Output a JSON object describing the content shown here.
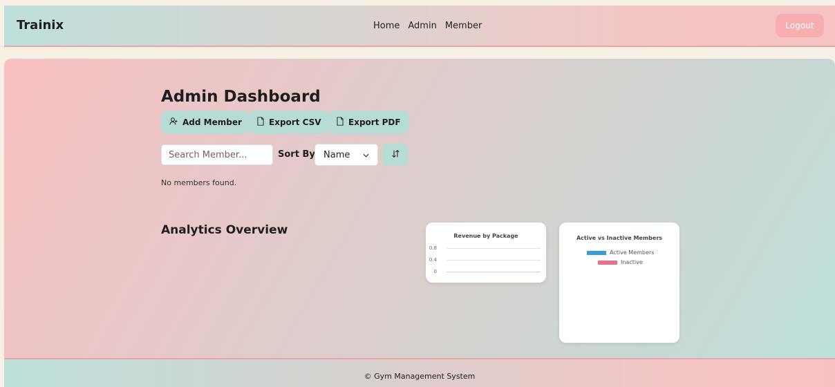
{
  "header": {
    "brand": "Trainix",
    "nav": [
      "Home",
      "Admin",
      "Member"
    ],
    "logout_label": "Logout"
  },
  "main": {
    "title": "Admin Dashboard",
    "buttons": {
      "add_member": "Add Member",
      "export_csv": "Export CSV",
      "export_pdf": "Export PDF"
    },
    "search": {
      "placeholder": "Search Member...",
      "value": ""
    },
    "sort": {
      "label": "Sort By:",
      "selected": "Name"
    },
    "empty_message": "No members found.",
    "analytics_title": "Analytics Overview"
  },
  "chart_data": [
    {
      "type": "bar",
      "title": "Revenue by Package",
      "categories": [],
      "values": [],
      "yticks": [
        "0.8",
        "0.4",
        "0"
      ],
      "ylim": [
        0,
        0.8
      ],
      "grid": true
    },
    {
      "type": "pie",
      "title": "Active vs Inactive Members",
      "legend": [
        {
          "label": "Active Members",
          "color": "#3b9bd6"
        },
        {
          "label": "Inactive",
          "color": "#ef6f8b"
        }
      ],
      "values": [],
      "legend_position": "top"
    }
  ],
  "footer": {
    "text": "© Gym Management System"
  },
  "colors": {
    "accent_button": "#b7dcd5",
    "logout": "#f7aeb0"
  }
}
